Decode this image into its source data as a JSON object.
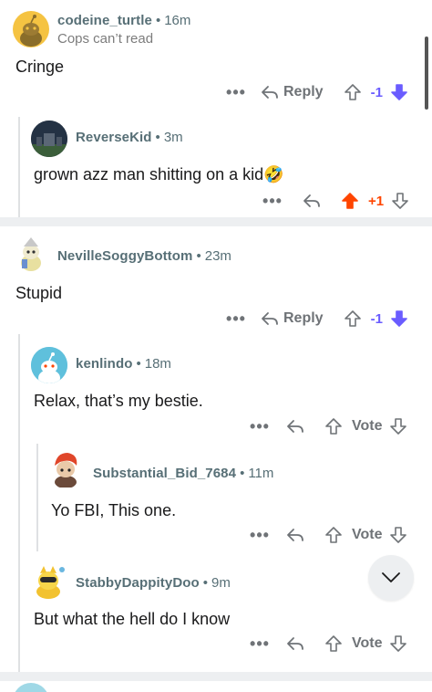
{
  "colors": {
    "upvote": "#ff4500",
    "downvote": "#6a5cff",
    "meta": "#576f76",
    "divider": "#edeff1"
  },
  "comments": [
    {
      "username": "codeine_turtle",
      "time": "16m",
      "flair": "Cops can’t read",
      "body": "Cringe",
      "score": "-1",
      "vote_state": "down",
      "action": "Reply"
    },
    {
      "username": "ReverseKid",
      "time": "3m",
      "body": "grown azz man shitting on a kid",
      "emoji": "🤣",
      "score": "+1",
      "vote_state": "up"
    },
    {
      "username": "NevilleSoggyBottom",
      "time": "23m",
      "body": "Stupid",
      "score": "-1",
      "vote_state": "down",
      "action": "Reply"
    },
    {
      "username": "kenlindo",
      "time": "18m",
      "body": "Relax, that’s my bestie.",
      "vote_label": "Vote"
    },
    {
      "username": "Substantial_Bid_7684",
      "time": "11m",
      "body": "Yo FBI, This one.",
      "vote_label": "Vote"
    },
    {
      "username": "StabbyDappityDoo",
      "time": "9m",
      "body": "But what the hell do I know",
      "vote_label": "Vote"
    }
  ],
  "ui": {
    "more_icon": "more-dots-icon",
    "reply_icon": "reply-arrow-icon",
    "scroll_icon": "chevron-down-icon",
    "separator": "•",
    "more": "•••"
  }
}
